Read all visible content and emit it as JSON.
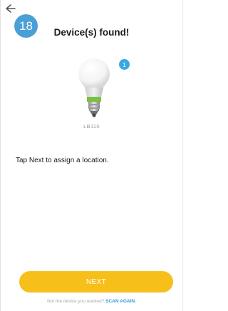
{
  "header": {
    "back_icon": "arrow-left-icon",
    "step_number": "18",
    "title": "Device(s) found!"
  },
  "device": {
    "icon": "smart-bulb-icon",
    "count_badge": "1",
    "model": "LB110"
  },
  "instruction": "Tap Next to assign a location.",
  "actions": {
    "next_label": "NEXT",
    "footer_prompt": "Not the device you wanted?",
    "scan_again_label": "SCAN AGAIN."
  },
  "colors": {
    "step_badge": "#4a9fd6",
    "count_badge": "#38a9e0",
    "next_button": "#f6bf1a",
    "link": "#2d9ad8"
  }
}
